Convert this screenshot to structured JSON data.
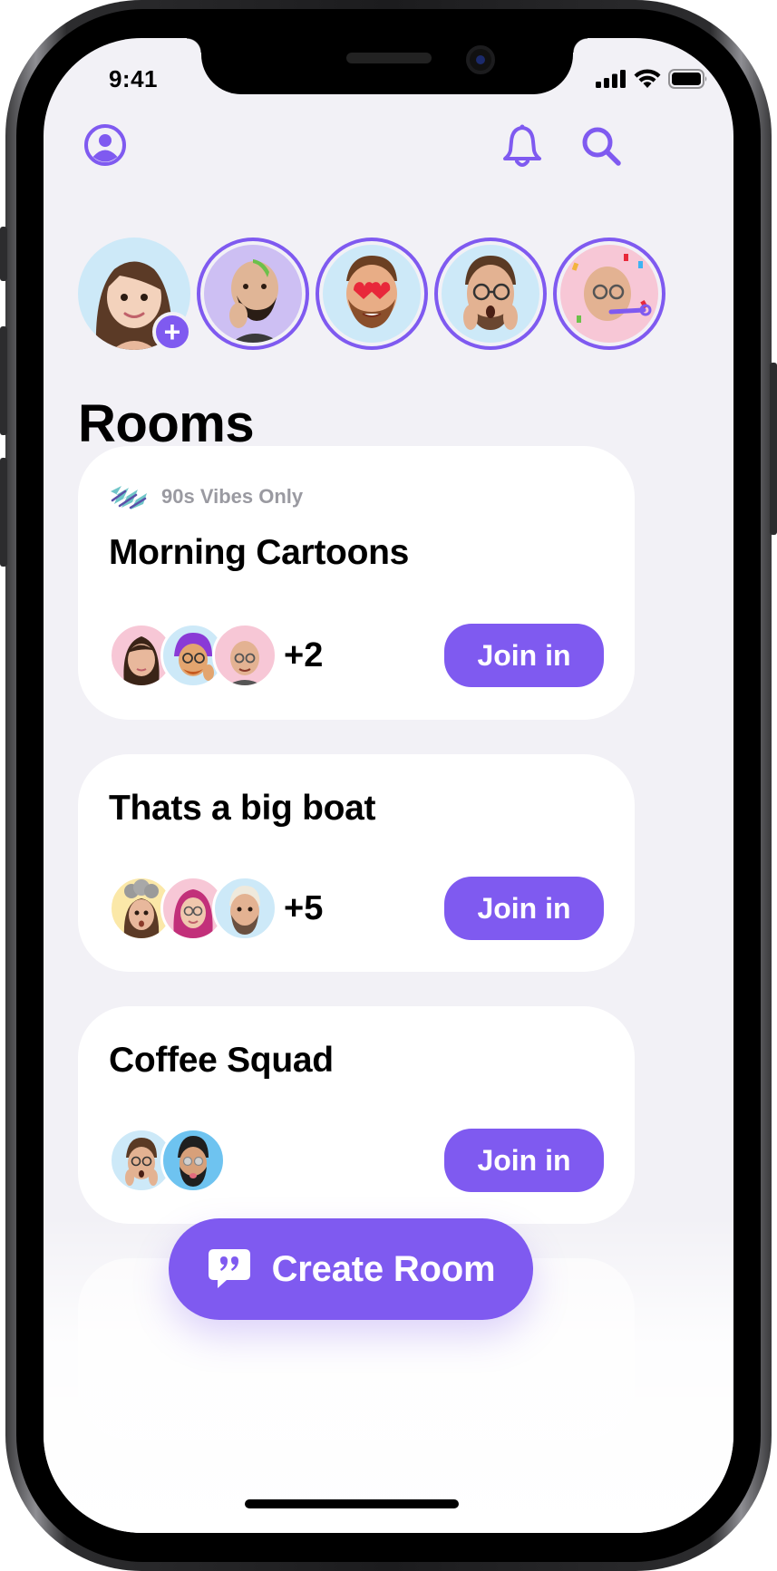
{
  "status_bar": {
    "time": "9:41"
  },
  "header": {
    "profile_icon": "person-circle-icon",
    "bell_icon": "bell-icon",
    "search_icon": "search-icon"
  },
  "stories": [
    {
      "name": "me",
      "add_label": "+",
      "bg": "#cde9f8"
    },
    {
      "name": "friend-2",
      "bg": "#cdbff3"
    },
    {
      "name": "friend-3",
      "bg": "#cde9f8"
    },
    {
      "name": "friend-4",
      "bg": "#cde9f8"
    },
    {
      "name": "friend-5",
      "bg": "#f7c7d6"
    }
  ],
  "section_title": "Rooms",
  "rooms": [
    {
      "tag": "90s Vibes Only",
      "title": "Morning Cartoons",
      "more": "+2",
      "join_label": "Join in",
      "avatar_bgs": [
        "#f7c7d6",
        "#cde9f8",
        "#f7c7d6"
      ]
    },
    {
      "title": "Thats a big boat",
      "more": "+5",
      "join_label": "Join in",
      "avatar_bgs": [
        "#fbe8a8",
        "#f7c7d6",
        "#cde9f8"
      ]
    },
    {
      "title": "Coffee Squad",
      "join_label": "Join in",
      "avatar_bgs": [
        "#cde9f8",
        "#6ec3f0"
      ]
    }
  ],
  "create_room": {
    "label": "Create Room",
    "icon": "quote-bubble-icon"
  },
  "colors": {
    "accent": "#7f5af0",
    "background": "#f2f1f6",
    "card": "#ffffff"
  }
}
